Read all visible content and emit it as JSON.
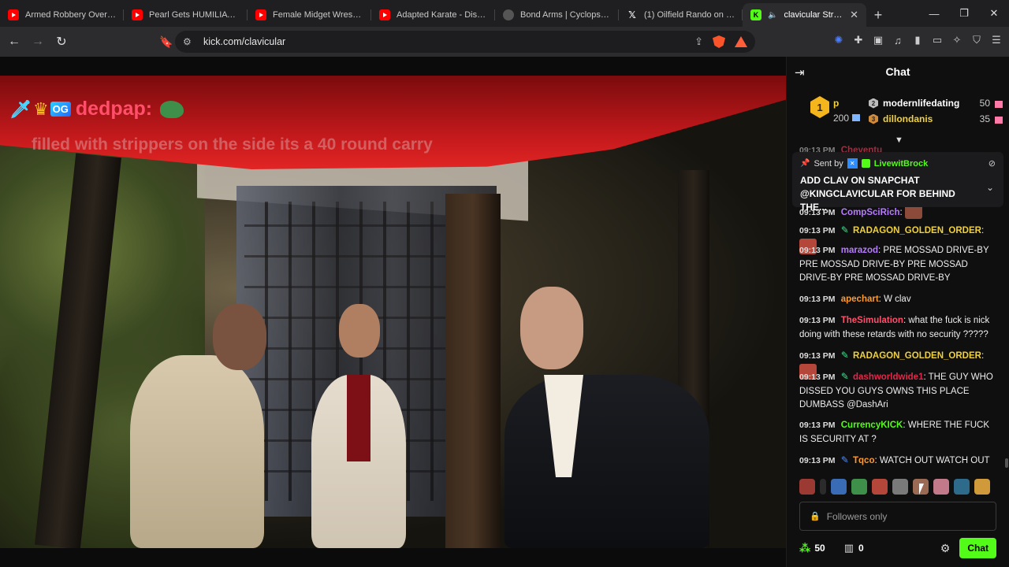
{
  "browser": {
    "tabs": [
      {
        "title": "Armed Robbery Over Pok",
        "favicon": "youtube-icon"
      },
      {
        "title": "Pearl Gets HUMILIATED In",
        "favicon": "youtube-icon"
      },
      {
        "title": "Female Midget Wrestling",
        "favicon": "youtube-icon"
      },
      {
        "title": "Adapted Karate - Disability",
        "favicon": "youtube-icon"
      },
      {
        "title": "Bond Arms | Cyclops®.50",
        "favicon": "globe-icon"
      },
      {
        "title": "(1) Oilfield Rando on X: \"",
        "favicon": "x-icon"
      },
      {
        "title": "clavicular Stream -",
        "favicon": "kick-icon",
        "active": true
      }
    ],
    "url": "kick.com/clavicular"
  },
  "video": {
    "overlay_username": "dedpap:",
    "overlay_badge_text": "OG",
    "overlay_message": "filled with strippers on the side its a 40 round carry"
  },
  "chat": {
    "title": "Chat",
    "leaderboard": {
      "first": {
        "rank": "1",
        "name": "p",
        "count": "200"
      },
      "second": {
        "rank": "2",
        "name": "modernlifedating",
        "count": "50"
      },
      "third": {
        "rank": "3",
        "name": "dillondanis",
        "count": "35"
      }
    },
    "pinned": {
      "sent_by_label": "Sent by",
      "user": "LivewitBrock",
      "message": "ADD CLAV ON SNAPCHAT @KINGCLAVICULAR FOR BEHIND THE..."
    },
    "messages": [
      {
        "time": "09:13 PM",
        "user": "Cheventu",
        "text": ""
      },
      {
        "time": "09:13 PM",
        "user": "CompSciRich",
        "text": ""
      },
      {
        "time": "09:13 PM",
        "user": "RADAGON_GOLDEN_ORDER",
        "text": ""
      },
      {
        "time": "09:13 PM",
        "user": "marazod",
        "text": "PRE MOSSAD DRIVE-BY PRE MOSSAD DRIVE-BY PRE MOSSAD DRIVE-BY PRE MOSSAD DRIVE-BY"
      },
      {
        "time": "09:13 PM",
        "user": "apechart",
        "text": "W clav"
      },
      {
        "time": "09:13 PM",
        "user": "TheSimulation",
        "text": "what the fuck is nick doing with these retards with no security ?????"
      },
      {
        "time": "09:13 PM",
        "user": "RADAGON_GOLDEN_ORDER",
        "text": ""
      },
      {
        "time": "09:13 PM",
        "user": "dashworldwide1",
        "text": "THE GUY WHO DISSED YOU GUYS OWNS THIS PLACE DUMBASS @DashAri"
      },
      {
        "time": "09:13 PM",
        "user": "CurrencyKICK",
        "text": "WHERE THE FUCK IS SECURITY AT ?"
      },
      {
        "time": "09:13 PM",
        "user": "Tqco",
        "text": "WATCH OUT WATCH OUT"
      }
    ],
    "input_placeholder": "Followers only",
    "points": "50",
    "boxes": "0",
    "send_label": "Chat",
    "colors": {
      "kick_green": "#53fc18",
      "gold": "#f0d13b",
      "purple": "#b77bff",
      "pink": "#ff4f6a"
    }
  }
}
